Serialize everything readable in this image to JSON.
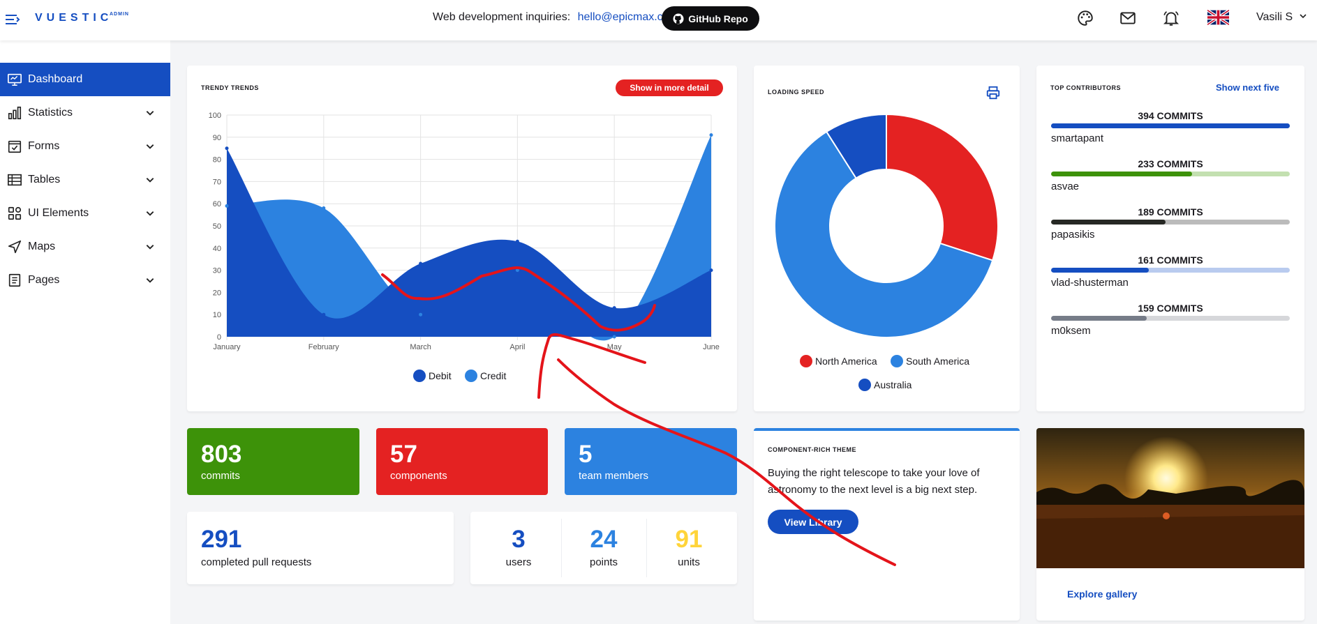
{
  "header": {
    "logo": "VUESTIC",
    "logo_sub": "ADMIN",
    "inquiry_text": "Web development inquiries:",
    "inquiry_email": "hello@epicmax.co",
    "github_label": "GitHub Repo",
    "user_name": "Vasili S"
  },
  "sidebar": {
    "items": [
      {
        "label": "Dashboard",
        "icon": "monitor-icon",
        "active": true
      },
      {
        "label": "Statistics",
        "icon": "bar-chart-icon"
      },
      {
        "label": "Forms",
        "icon": "checkbox-icon"
      },
      {
        "label": "Tables",
        "icon": "table-icon"
      },
      {
        "label": "UI Elements",
        "icon": "grid-icon"
      },
      {
        "label": "Maps",
        "icon": "navigation-icon"
      },
      {
        "label": "Pages",
        "icon": "document-icon"
      }
    ]
  },
  "trends": {
    "title": "TRENDY TRENDS",
    "button": "Show in more detail"
  },
  "speed": {
    "title": "LOADING SPEED"
  },
  "contributors": {
    "title": "TOP CONTRIBUTORS",
    "link": "Show next five",
    "items": [
      {
        "commits": "394 COMMITS",
        "name": "smartapant",
        "fraction": 1.0,
        "color": "#154ec1",
        "track": "#154ec1"
      },
      {
        "commits": "233 COMMITS",
        "name": "asvae",
        "fraction": 0.59,
        "color": "#3d9209",
        "track": "#c3e0b0"
      },
      {
        "commits": "189 COMMITS",
        "name": "papasikis",
        "fraction": 0.48,
        "color": "#262824",
        "track": "#bbbbbb"
      },
      {
        "commits": "161 COMMITS",
        "name": "vlad-shusterman",
        "fraction": 0.41,
        "color": "#154ec1",
        "track": "#b9cbef"
      },
      {
        "commits": "159 COMMITS",
        "name": "m0ksem",
        "fraction": 0.4,
        "color": "#767c88",
        "track": "#d6d7da"
      }
    ]
  },
  "stats": [
    {
      "value": "803",
      "label": "commits",
      "color": "#3d9209"
    },
    {
      "value": "57",
      "label": "components",
      "color": "#e42222"
    },
    {
      "value": "5",
      "label": "team members",
      "color": "#2c82e0"
    }
  ],
  "pull_requests": {
    "value": "291",
    "label": "completed pull requests"
  },
  "mini_stats": [
    {
      "value": "3",
      "label": "users",
      "color": "#154ec1"
    },
    {
      "value": "24",
      "label": "points",
      "color": "#2c82e0"
    },
    {
      "value": "91",
      "label": "units",
      "color": "#ffd43a"
    }
  ],
  "theme": {
    "title": "COMPONENT-RICH THEME",
    "text": "Buying the right telescope to take your love of astronomy to the next level is a big next step.",
    "button": "View Library"
  },
  "gallery": {
    "link": "Explore gallery"
  },
  "colors": {
    "primary": "#154ec1",
    "info": "#2c82e0",
    "danger": "#e42222",
    "success": "#3d9209",
    "warning": "#ffd43a"
  },
  "chart_data": [
    {
      "type": "area",
      "title": "",
      "categories": [
        "January",
        "February",
        "March",
        "April",
        "May",
        "June"
      ],
      "ylim": [
        0,
        100
      ],
      "yticks": [
        0,
        10,
        20,
        30,
        40,
        50,
        60,
        70,
        80,
        90,
        100
      ],
      "grid": true,
      "legend": "bottom",
      "series": [
        {
          "name": "Debit",
          "color": "#154ec1",
          "values": [
            85,
            10,
            33,
            43,
            13,
            30
          ]
        },
        {
          "name": "Credit",
          "color": "#2c82e0",
          "values": [
            59,
            58,
            10,
            30,
            0,
            91
          ]
        }
      ]
    },
    {
      "type": "pie",
      "donut": true,
      "legend": "bottom",
      "labels": [
        "North America",
        "South America",
        "Australia"
      ],
      "values": [
        30,
        61,
        9
      ],
      "colors": [
        "#e42222",
        "#2c82e0",
        "#154ec1"
      ]
    }
  ]
}
